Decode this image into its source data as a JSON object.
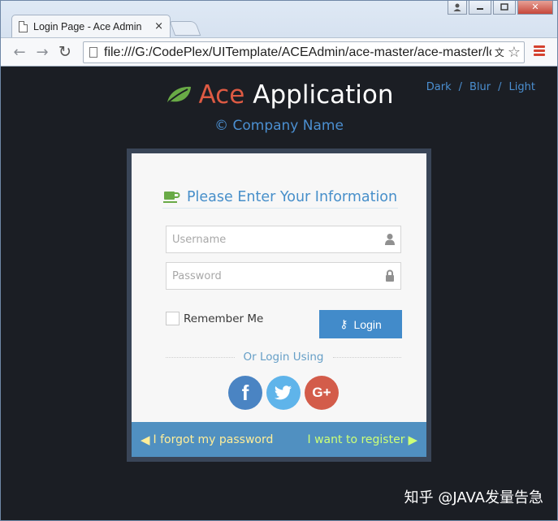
{
  "browser": {
    "tab_title": "Login Page - Ace Admin",
    "tab_close": "×",
    "url": "file:///G:/CodePlex/UITemplate/ACEAdmin/ace-master/ace-master/login.html",
    "back_glyph": "←",
    "forward_glyph": "→",
    "reload_glyph": "↻",
    "translate_glyph": "文",
    "bookmark_glyph": "☆",
    "minimize_glyph": "▁",
    "maximize_glyph": "❐",
    "close_glyph": "✕",
    "user_glyph": "👤",
    "accent_color": "#d4412e"
  },
  "themes": {
    "dark": "Dark",
    "blur": "Blur",
    "light": "Light",
    "separator": "/"
  },
  "brand": {
    "ace": "Ace",
    "application": "Application",
    "company": "© Company Name",
    "ace_color": "#dd5a43",
    "leaf_color": "#69aa46",
    "icon": "leaf-icon"
  },
  "login": {
    "heading": "Please Enter Your Information",
    "heading_icon": "coffee-icon",
    "username_placeholder": "Username",
    "password_placeholder": "Password",
    "username_value": "",
    "password_value": "",
    "remember_label": "Remember Me",
    "remember_checked": false,
    "login_label": "Login",
    "key_glyph": "⚷",
    "or_text": "Or Login Using",
    "social": {
      "facebook": "f",
      "twitter": "t",
      "google": "G+"
    },
    "forgot": "I forgot my password",
    "register": "I want to register",
    "left_arrow": "◀",
    "right_arrow": "▶"
  },
  "watermark": "知乎 @JAVA发量告急"
}
